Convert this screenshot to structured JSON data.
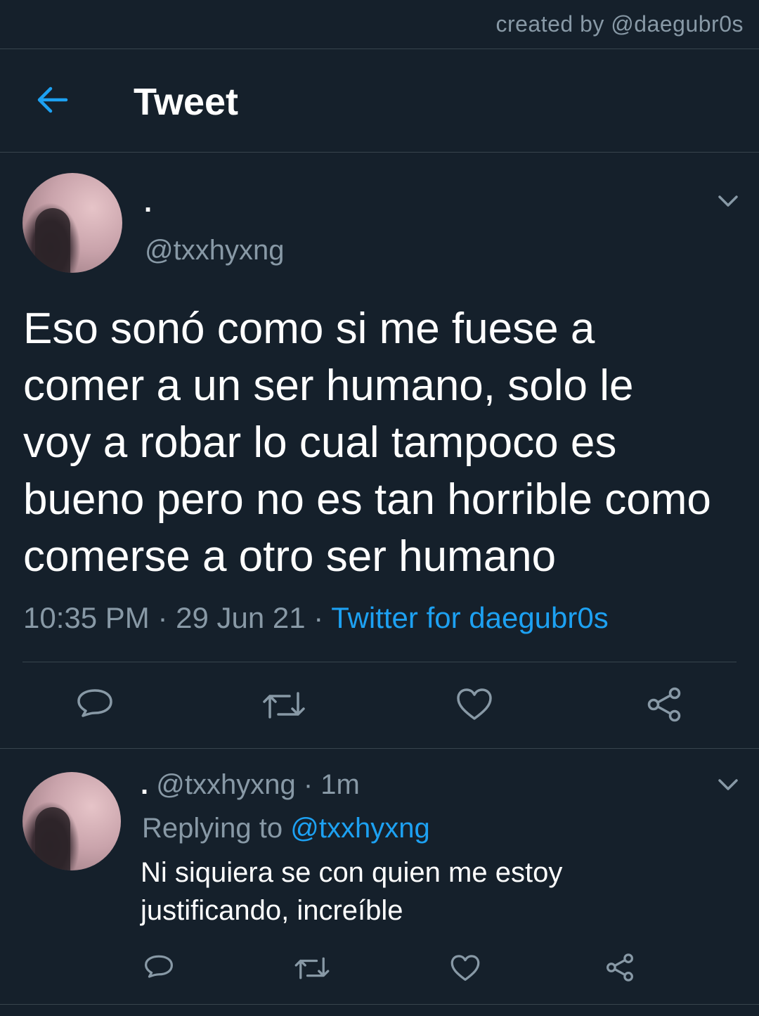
{
  "credit": "created by @daegubr0s",
  "header": {
    "title": "Tweet"
  },
  "tweet": {
    "display_name": ".",
    "handle": "@txxhyxng",
    "text": "Eso sonó como si me fuese a\ncomer a un ser humano, solo le\nvoy a robar lo cual tampoco es\nbueno pero no es tan horrible como\ncomerse a otro ser humano",
    "time": "10:35 PM",
    "sep": "·",
    "date": "29 Jun 21",
    "source": "Twitter for daegubr0s"
  },
  "reply": {
    "display_name": ".",
    "handle": "@txxhyxng",
    "sep": "·",
    "age": "1m",
    "replying_label": "Replying to",
    "replying_handle": "@txxhyxng",
    "text": "Ni siquiera se con quien me estoy\njustificando, increíble"
  },
  "colors": {
    "background": "#15202b",
    "accent": "#1da1f2",
    "muted": "#8899a6",
    "divider": "#38444d"
  },
  "icons": [
    "back-arrow-icon",
    "chevron-down-icon",
    "comment-icon",
    "retweet-icon",
    "heart-icon",
    "share-icon"
  ]
}
